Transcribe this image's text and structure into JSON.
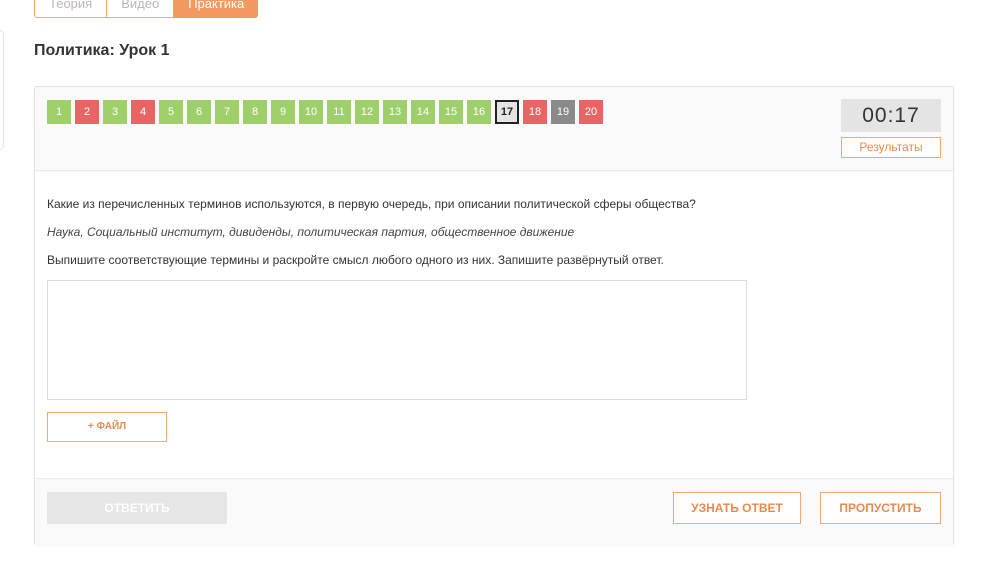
{
  "tabs": [
    {
      "label": "Теория",
      "active": false
    },
    {
      "label": "Видео",
      "active": false
    },
    {
      "label": "Практика",
      "active": true
    }
  ],
  "page_title": "Политика: Урок 1",
  "questions": [
    {
      "label": "1",
      "status": "green"
    },
    {
      "label": "2",
      "status": "red"
    },
    {
      "label": "3",
      "status": "green"
    },
    {
      "label": "4",
      "status": "red"
    },
    {
      "label": "5",
      "status": "green"
    },
    {
      "label": "6",
      "status": "green"
    },
    {
      "label": "7",
      "status": "green"
    },
    {
      "label": "8",
      "status": "green"
    },
    {
      "label": "9",
      "status": "green"
    },
    {
      "label": "10",
      "status": "green"
    },
    {
      "label": "11",
      "status": "green"
    },
    {
      "label": "12",
      "status": "green"
    },
    {
      "label": "13",
      "status": "green"
    },
    {
      "label": "14",
      "status": "green"
    },
    {
      "label": "15",
      "status": "green"
    },
    {
      "label": "16",
      "status": "green"
    },
    {
      "label": "17",
      "status": "current"
    },
    {
      "label": "18",
      "status": "red"
    },
    {
      "label": "19",
      "status": "gray"
    },
    {
      "label": "20",
      "status": "red"
    }
  ],
  "timer": "00:17",
  "results_label": "Результаты",
  "question": {
    "line1": "Какие из перечисленных терминов используются, в первую очередь, при описании политической сферы общества?",
    "line2": "Наука, Социальный институт, дивиденды, политическая партия, общественное движение",
    "line3": "Выпишите соответствующие термины и раскройте смысл любого одного из них. Запишите развёрнутый ответ."
  },
  "answer_value": "",
  "file_label": "+ ФАЙЛ",
  "footer": {
    "answer_label": "ОТВЕТИТЬ",
    "show_answer_label": "УЗНАТЬ ОТВЕТ",
    "skip_label": "ПРОПУСТИТЬ"
  },
  "colors": {
    "accent": "#f39a63",
    "green": "#9fcf6b",
    "red": "#e96565",
    "gray": "#8a8a8a"
  }
}
